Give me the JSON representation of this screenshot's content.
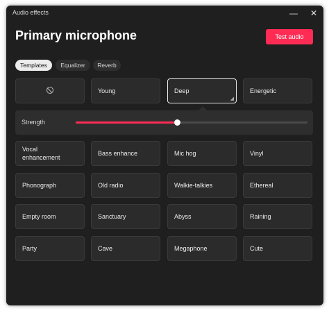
{
  "window": {
    "title": "Audio effects",
    "minimize_glyph": "—",
    "close_glyph": "✕"
  },
  "header": {
    "title": "Primary microphone",
    "test_button": "Test audio"
  },
  "tabs": [
    {
      "label": "Templates",
      "active": true
    },
    {
      "label": "Equalizer",
      "active": false
    },
    {
      "label": "Reverb",
      "active": false
    }
  ],
  "templates": {
    "none_icon": "no-effect-icon",
    "row1": [
      "Young",
      "Deep",
      "Energetic"
    ],
    "selected": "Deep",
    "resize_glyph": "◢"
  },
  "strength": {
    "label": "Strength",
    "value_fraction": 0.44
  },
  "effects": [
    [
      "Vocal\nenhancement",
      "Bass enhance",
      "Mic hog",
      "Vinyl"
    ],
    [
      "Phonograph",
      "Old radio",
      "Walkie-talkies",
      "Ethereal"
    ],
    [
      "Empty room",
      "Sanctuary",
      "Abyss",
      "Raining"
    ],
    [
      "Party",
      "Cave",
      "Megaphone",
      "Cute"
    ]
  ],
  "colors": {
    "accent": "#fe2c55",
    "background": "#1f1f1f",
    "card": "#2b2b2b"
  }
}
